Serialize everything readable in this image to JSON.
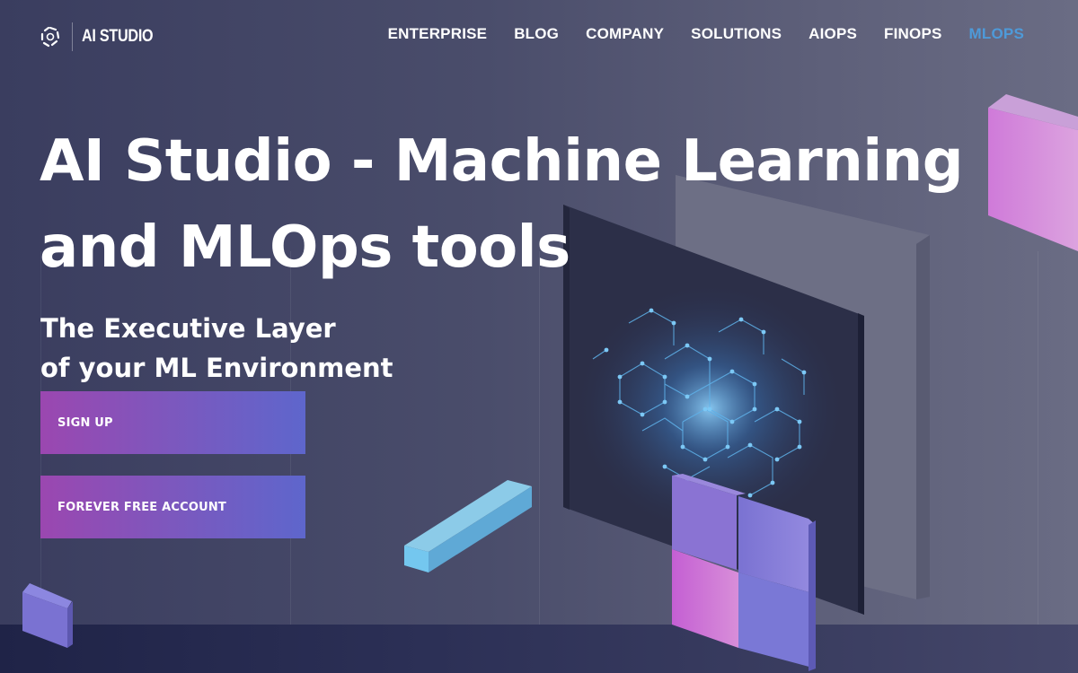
{
  "brand": {
    "name": "AI STUDIO",
    "logo_icon": "hexagon-swirl-logo-icon"
  },
  "nav": {
    "items": [
      {
        "label": "ENTERPRISE",
        "active": false
      },
      {
        "label": "BLOG",
        "active": false
      },
      {
        "label": "COMPANY",
        "active": false
      },
      {
        "label": "SOLUTIONS",
        "active": false
      },
      {
        "label": "AIOPS",
        "active": false
      },
      {
        "label": "FINOPS",
        "active": false
      },
      {
        "label": "MLOPS",
        "active": true
      }
    ],
    "active_color": "#4e9ad9"
  },
  "hero": {
    "title_line1": "AI Studio - Machine Learning",
    "title_line2": "and MLOps tools",
    "subtitle_line1": "The Executive Layer",
    "subtitle_line2": "of your ML Environment",
    "buttons": {
      "signup": "SIGN UP",
      "free_account": "FOREVER FREE ACCOUNT"
    },
    "button_gradient": [
      "#9b47b0",
      "#5e66cc"
    ]
  },
  "illustration": {
    "description": "isometric neural-network panel with blocks",
    "accent_colors": {
      "cyan": "#6cc4ea",
      "pink": "#c963d4",
      "violet": "#8379d8"
    }
  }
}
